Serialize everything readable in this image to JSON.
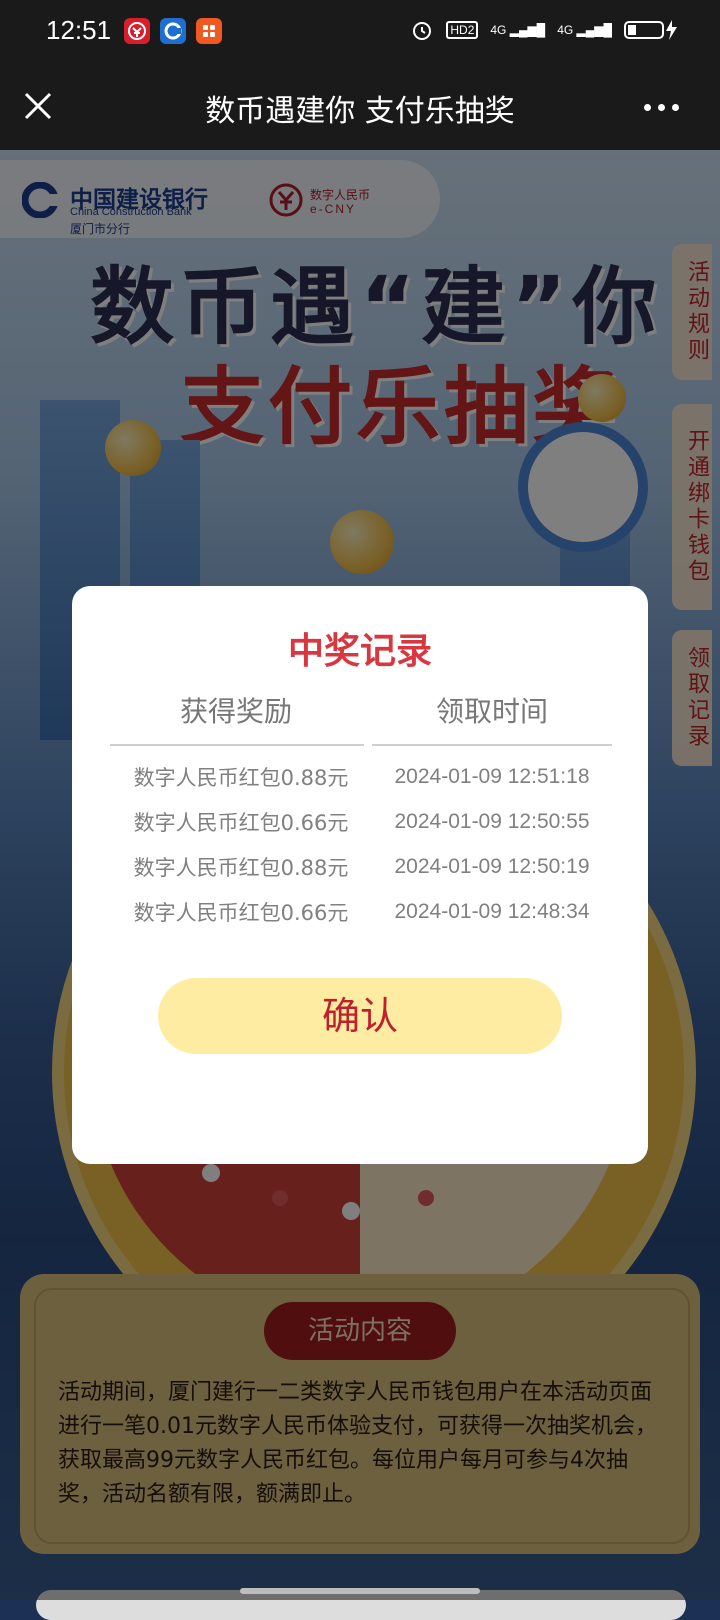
{
  "status_bar": {
    "time": "12:51",
    "right_icons": [
      "alarm-icon",
      "hd-icon",
      "signal-4g-icon",
      "signal-4g-icon",
      "battery-charging-icon"
    ],
    "hd_label": "HD2",
    "net1_label": "4G",
    "net2_label": "4G"
  },
  "nav": {
    "title": "数币遇建你 支付乐抽奖"
  },
  "brand": {
    "bank_cn": "中国建设银行",
    "bank_en": "China Construction Bank",
    "branch": "厦门市分行",
    "ecny_cn": "数字人民币",
    "ecny_en": "e-CNY"
  },
  "hero": {
    "line1": "数币遇“建”你",
    "line2": "支付乐抽奖"
  },
  "side_tabs": {
    "rules": "活动规则",
    "open_wallet": "开通绑卡钱包",
    "records": "领取记录"
  },
  "activity": {
    "title": "活动内容",
    "text": "活动期间，厦门建行一二类数字人民币钱包用户在本活动页面进行一笔0.01元数字人民币体验支付，可获得一次抽奖机会，获取最高99元数字人民币红包。每位用户每月可参与4次抽奖，活动名额有限，额满即止。"
  },
  "modal": {
    "title": "中奖记录",
    "col_reward": "获得奖励",
    "col_time": "领取时间",
    "rows": [
      {
        "reward": "数字人民币红包0.88元",
        "time": "2024-01-09 12:51:18"
      },
      {
        "reward": "数字人民币红包0.66元",
        "time": "2024-01-09 12:50:55"
      },
      {
        "reward": "数字人民币红包0.88元",
        "time": "2024-01-09 12:50:19"
      },
      {
        "reward": "数字人民币红包0.66元",
        "time": "2024-01-09 12:48:34"
      }
    ],
    "confirm_label": "确认"
  }
}
